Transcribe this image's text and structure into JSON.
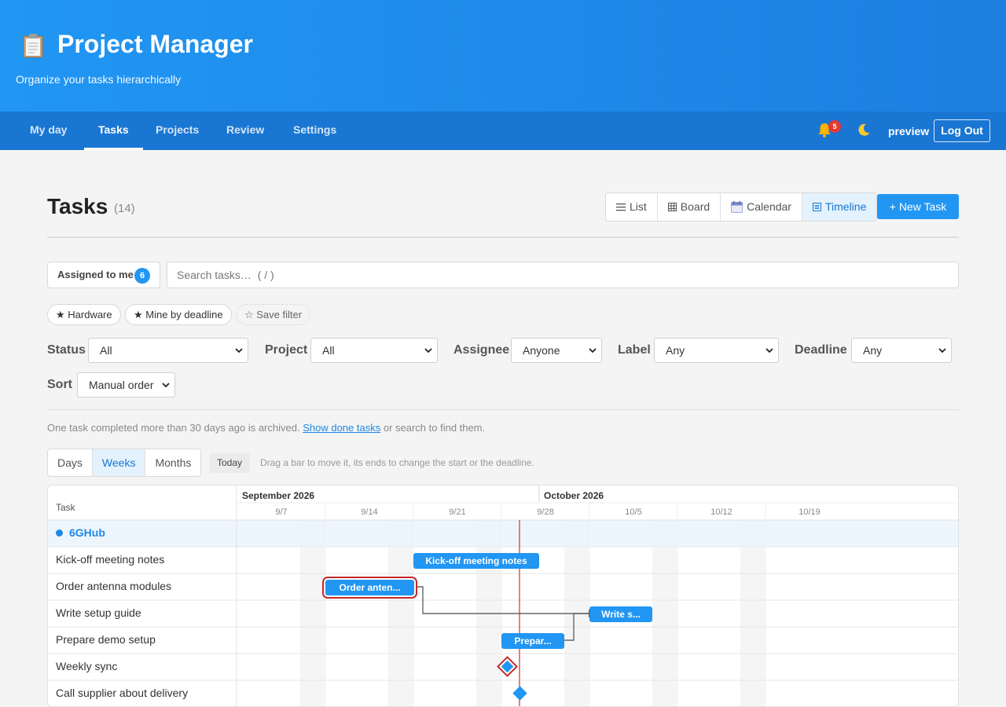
{
  "app": {
    "title": "Project Manager",
    "subtitle": "Organize your tasks hierarchically",
    "logo_icon": "clipboard-icon"
  },
  "nav": {
    "tabs": [
      {
        "label": "My day",
        "active": false
      },
      {
        "label": "Tasks",
        "active": true
      },
      {
        "label": "Projects",
        "active": false
      },
      {
        "label": "Review",
        "active": false
      },
      {
        "label": "Settings",
        "active": false
      }
    ],
    "notifications_count": "5",
    "user": "preview",
    "logout_label": "Log Out"
  },
  "page": {
    "title": "Tasks",
    "count": "(14)",
    "views": [
      {
        "label": "List",
        "icon": "list-icon",
        "active": false
      },
      {
        "label": "Board",
        "icon": "board-icon",
        "active": false
      },
      {
        "label": "Calendar",
        "icon": "calendar-icon",
        "active": false
      },
      {
        "label": "Timeline",
        "icon": "timeline-icon",
        "active": true
      }
    ],
    "new_task_label": "+ New Task"
  },
  "filters": {
    "assigned_label": "Assigned to me",
    "assigned_count": "6",
    "search_placeholder": "Search tasks…  ( / )",
    "saved_chips": [
      "★ Hardware",
      "★ Mine by deadline"
    ],
    "save_filter_label": "☆ Save filter",
    "status": {
      "label": "Status",
      "value": "All"
    },
    "project": {
      "label": "Project",
      "value": "All"
    },
    "assignee": {
      "label": "Assignee",
      "value": "Anyone"
    },
    "label": {
      "label": "Label",
      "value": "Any"
    },
    "deadline": {
      "label": "Deadline",
      "value": "Any"
    },
    "sort": {
      "label": "Sort",
      "value": "Manual order"
    }
  },
  "archive": {
    "prefix": "One task completed more than 30 days ago is archived.",
    "link": "Show done tasks",
    "suffix": "or search to find them."
  },
  "timeline": {
    "zoom": [
      {
        "label": "Days",
        "active": false
      },
      {
        "label": "Weeks",
        "active": true
      },
      {
        "label": "Months",
        "active": false
      }
    ],
    "today_label": "Today",
    "hint": "Drag a bar to move it, its ends to change the start or the deadline.",
    "task_column_header": "Task",
    "months": [
      "September 2026",
      "October 2026"
    ],
    "weeks": [
      "9/7",
      "9/14",
      "9/21",
      "9/28",
      "10/5",
      "10/12",
      "10/19"
    ],
    "group": "6GHub",
    "rows": [
      {
        "name": "Kick-off meeting notes",
        "bar_label": "Kick-off meeting notes",
        "kind": "bar",
        "start": "9/22",
        "end": "10/2"
      },
      {
        "name": "Order antenna modules",
        "bar_label": "Order anten...",
        "kind": "bar",
        "start": "9/14",
        "end": "9/22",
        "selected": true
      },
      {
        "name": "Write setup guide",
        "bar_label": "Write s...",
        "kind": "bar",
        "start": "10/5",
        "end": "10/10"
      },
      {
        "name": "Prepare demo setup",
        "bar_label": "Prepar...",
        "kind": "bar",
        "start": "9/28",
        "end": "10/3"
      },
      {
        "name": "Weekly sync",
        "kind": "milestone",
        "date": "9/28",
        "selected": true
      },
      {
        "name": "Call supplier about delivery",
        "kind": "milestone",
        "date": "9/29"
      }
    ],
    "colors": {
      "bar": "#2196f3",
      "today_line": "#d32f2f",
      "selected_outline": "#c62828"
    }
  }
}
